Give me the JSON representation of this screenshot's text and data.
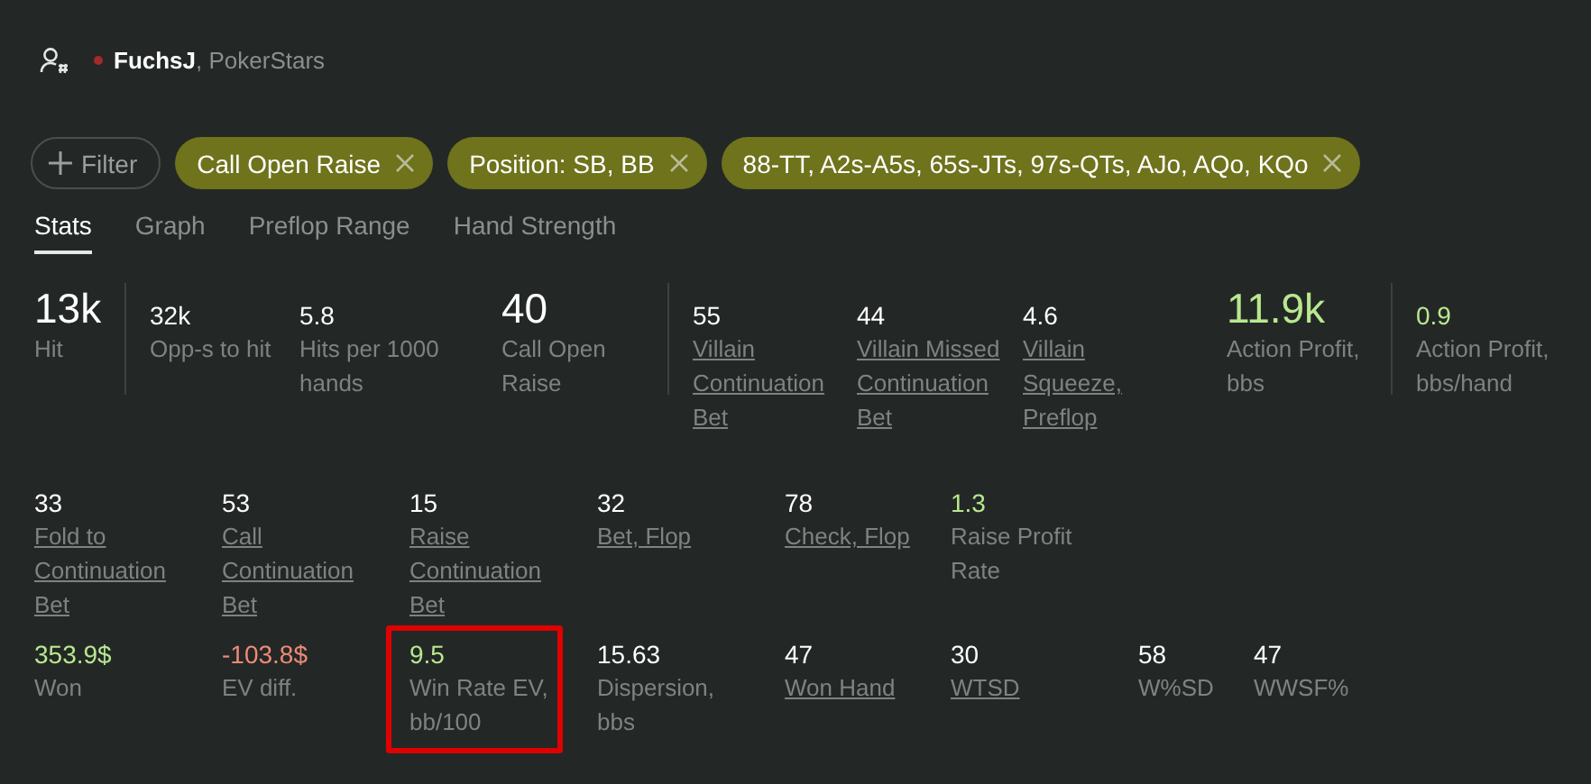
{
  "player": {
    "name": "FuchsJ",
    "site": ", PokerStars"
  },
  "filters": {
    "add_label": "Filter",
    "chips": [
      {
        "label": "Call Open Raise"
      },
      {
        "label": "Position: SB, BB"
      },
      {
        "label": "88-TT, A2s-A5s, 65s-JTs, 97s-QTs, AJo, AQo, KQo"
      }
    ]
  },
  "tabs": [
    {
      "label": "Stats",
      "selected": true
    },
    {
      "label": "Graph",
      "selected": false
    },
    {
      "label": "Preflop Range",
      "selected": false
    },
    {
      "label": "Hand Strength",
      "selected": false
    }
  ],
  "stat_rows": [
    {
      "groups": [
        [
          {
            "value": "13k",
            "label": "Hit",
            "kind": "big",
            "color": "#ffffff",
            "link": false
          }
        ],
        [
          {
            "value": "32k",
            "label": "Opp-s to hit",
            "kind": "small",
            "color": "#ffffff",
            "link": false
          },
          {
            "value": "5.8",
            "label": "Hits per 1000 hands",
            "kind": "small",
            "color": "#ffffff",
            "link": false
          },
          {
            "value": "40",
            "label": "Call Open Raise",
            "kind": "big",
            "color": "#ffffff",
            "link": false
          }
        ],
        [
          {
            "value": "55",
            "label": "Villain Continuation Bet",
            "kind": "small",
            "color": "#ffffff",
            "link": true
          },
          {
            "value": "44",
            "label": "Villain Missed Continuation Bet",
            "kind": "small",
            "color": "#ffffff",
            "link": true
          },
          {
            "value": "4.6",
            "label": "Villain Squeeze, Preflop",
            "kind": "small",
            "color": "#ffffff",
            "link": true
          },
          {
            "value": "11.9k",
            "label": "Action Profit, bbs",
            "kind": "big",
            "color": "#b9e88f",
            "link": false
          }
        ],
        [
          {
            "value": "0.9",
            "label": "Action Profit, bbs/hand",
            "kind": "small",
            "color": "#b9e88f",
            "link": false
          }
        ]
      ]
    },
    {
      "groups": [
        [
          {
            "value": "33",
            "label": "Fold to Continuation Bet",
            "kind": "small",
            "color": "#ffffff",
            "link": true
          },
          {
            "value": "53",
            "label": "Call Continuation Bet",
            "kind": "small",
            "color": "#ffffff",
            "link": true
          },
          {
            "value": "15",
            "label": "Raise Continuation Bet",
            "kind": "small",
            "color": "#ffffff",
            "link": true
          },
          {
            "value": "32",
            "label": "Bet, Flop",
            "kind": "small",
            "color": "#ffffff",
            "link": true
          },
          {
            "value": "78",
            "label": "Check, Flop",
            "kind": "small",
            "color": "#ffffff",
            "link": true
          },
          {
            "value": "1.3",
            "label": "Raise Profit Rate",
            "kind": "small",
            "color": "#b9e88f",
            "link": false
          }
        ]
      ]
    },
    {
      "groups": [
        [
          {
            "value": "353.9$",
            "label": "Won",
            "kind": "small",
            "color": "#b9e88f",
            "link": false
          },
          {
            "value": "-103.8$",
            "label": "EV diff.",
            "kind": "small",
            "color": "#ef8a78",
            "link": false
          },
          {
            "value": "9.5",
            "label": "Win Rate EV, bb/100",
            "kind": "small",
            "color": "#b9e88f",
            "link": false,
            "highlighted": true
          },
          {
            "value": "15.63",
            "label": "Dispersion, bbs",
            "kind": "small",
            "color": "#ffffff",
            "link": false
          },
          {
            "value": "47",
            "label": "Won Hand",
            "kind": "small",
            "color": "#ffffff",
            "link": true
          },
          {
            "value": "30",
            "label": "WTSD",
            "kind": "small",
            "color": "#ffffff",
            "link": true
          },
          {
            "value": "58",
            "label": "W%SD",
            "kind": "small",
            "color": "#ffffff",
            "link": false
          },
          {
            "value": "47",
            "label": "WWSF%",
            "kind": "small",
            "color": "#ffffff",
            "link": false
          }
        ]
      ]
    }
  ]
}
